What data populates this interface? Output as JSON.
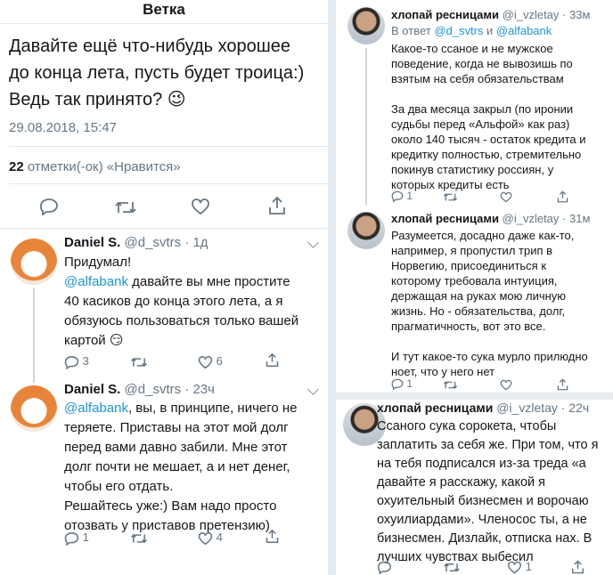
{
  "left": {
    "nav_title": "Ветка",
    "main_tweet": {
      "text_line1": "Давайте ещё что-нибудь хорошее",
      "text_line2": "до конца лета, пусть будет троица:)",
      "text_line3": "Ведь так принято? 😉",
      "timestamp": "29.08.2018, 15:47",
      "likes_count": "22",
      "likes_label": "отметки(-ок) «Нравится»"
    },
    "replies": [
      {
        "name": "Daniel S.",
        "handle": "@d_svtrs",
        "time": "· 1д",
        "line1": "Придумал!",
        "mention": "@alfabank",
        "line2": " давайте вы мне простите",
        "line3": "40 касиков до конца этого лета, а я",
        "line4": "обязуюсь пользоваться только вашей",
        "line5": "картой 😏",
        "replies": "3",
        "likes": "6"
      },
      {
        "name": "Daniel S.",
        "handle": "@d_svtrs",
        "time": "· 23ч",
        "mention": "@alfabank",
        "line1": ", вы, в принципе, ничего не",
        "line2": "теряете. Приставы на этот мой долг",
        "line3": "перед вами давно забили. Мне этот",
        "line4": "долг почти не мешает, а и нет денег,",
        "line5": "чтобы его отдать.",
        "line6": "Решайтесь уже:) Вам надо просто",
        "line7": "отозвать у приставов претензию)",
        "replies": "1",
        "likes": "4"
      }
    ]
  },
  "right_top": {
    "tweets": [
      {
        "name": "хлопай ресницами",
        "handle": "@i_vzletay",
        "time": "· 33м",
        "reply_prefix": "В ответ ",
        "reply_to1": "@d_svtrs",
        "reply_and": " и ",
        "reply_to2": "@alfabank",
        "lines": [
          "Какое-то сcаное и не мужское",
          "поведение, когда не вывозишь по",
          "взятым на себя обязательствам",
          "",
          "За два месяца закрыл (по иронии",
          "судьбы перед «Альфой» как раз)",
          "около 140 тысяч - остаток кредита и",
          "кредитку полностью, стремительно",
          "покинув статистику россиян, у",
          "которых кредиты есть"
        ],
        "replies": "1"
      },
      {
        "name": "хлопай ресницами",
        "handle": "@i_vzletay",
        "time": "· 31м",
        "lines": [
          "Разумеется, досадно даже как-то,",
          "например, я пропустил трип в",
          "Норвегию, присоединиться к",
          "которому требовала интуиция,",
          "держащая на руках мою личную",
          "жизнь. Но - обязательства, долг,",
          "прагматичность, вот это все.",
          "",
          "И тут какое-то сука мурло прилюдно",
          "ноет, что у него нет"
        ],
        "replies": "1"
      }
    ]
  },
  "right_bottom": {
    "name": "хлопай ресницами",
    "handle": "@i_vzletay",
    "time": "· 22ч",
    "lines": [
      "Ссаного сука сорокета, чтобы",
      "заплатить за себя же. При том, что я",
      "на тебя подписался из-за треда «а",
      "давайте я расскажу, какой я",
      "охуительный бизнесмен и ворочаю",
      "охуилиардами». Членосос ты, а не",
      "бизнесмен. Дизлайк, отписка нах. В",
      "лучших чувствах выбесил"
    ],
    "likes": "1"
  },
  "colors": {
    "link": "#1b95e0",
    "muted": "#657786",
    "divider": "#e1e8ed",
    "background_gap": "#e6ecf0"
  }
}
